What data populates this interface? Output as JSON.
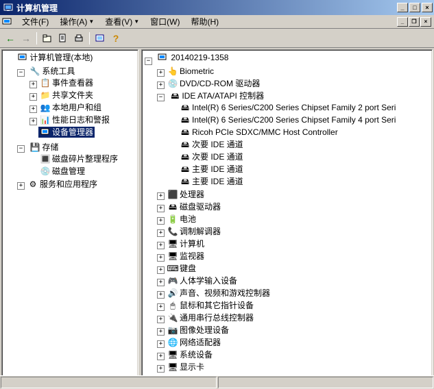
{
  "title": "计算机管理",
  "menus": {
    "file": "文件(F)",
    "action": "操作(A)",
    "view": "查看(V)",
    "window": "窗口(W)",
    "help": "帮助(H)"
  },
  "left_tree": {
    "root": "计算机管理(本地)",
    "system_tools": "系统工具",
    "event_viewer": "事件查看器",
    "shared_folders": "共享文件夹",
    "local_users": "本地用户和组",
    "perf_logs": "性能日志和警报",
    "device_manager": "设备管理器",
    "storage": "存储",
    "defrag": "磁盘碎片整理程序",
    "disk_mgmt": "磁盘管理",
    "services_apps": "服务和应用程序"
  },
  "right_tree": {
    "computer": "20140219-1358",
    "biometric": "Biometric",
    "dvdcd": "DVD/CD-ROM 驱动器",
    "ide_atapi": "IDE ATA/ATAPI 控制器",
    "intel_2port": "Intel(R) 6 Series/C200 Series Chipset Family 2 port Seri",
    "intel_4port": "Intel(R) 6 Series/C200 Series Chipset Family 4 port Seri",
    "ricoh": "Ricoh PCIe SDXC/MMC Host Controller",
    "sec_ide_1": "次要 IDE 通道",
    "sec_ide_2": "次要 IDE 通道",
    "pri_ide_1": "主要 IDE 通道",
    "pri_ide_2": "主要 IDE 通道",
    "processor": "处理器",
    "disk_drives": "磁盘驱动器",
    "battery": "电池",
    "modem": "调制解调器",
    "computer_cat": "计算机",
    "monitor": "监视器",
    "keyboard": "键盘",
    "hid": "人体学输入设备",
    "sound": "声音、视频和游戏控制器",
    "mouse": "鼠标和其它指针设备",
    "usb": "通用串行总线控制器",
    "imaging": "图像处理设备",
    "network": "网络适配器",
    "system_dev": "系统设备",
    "display": "显示卡"
  }
}
